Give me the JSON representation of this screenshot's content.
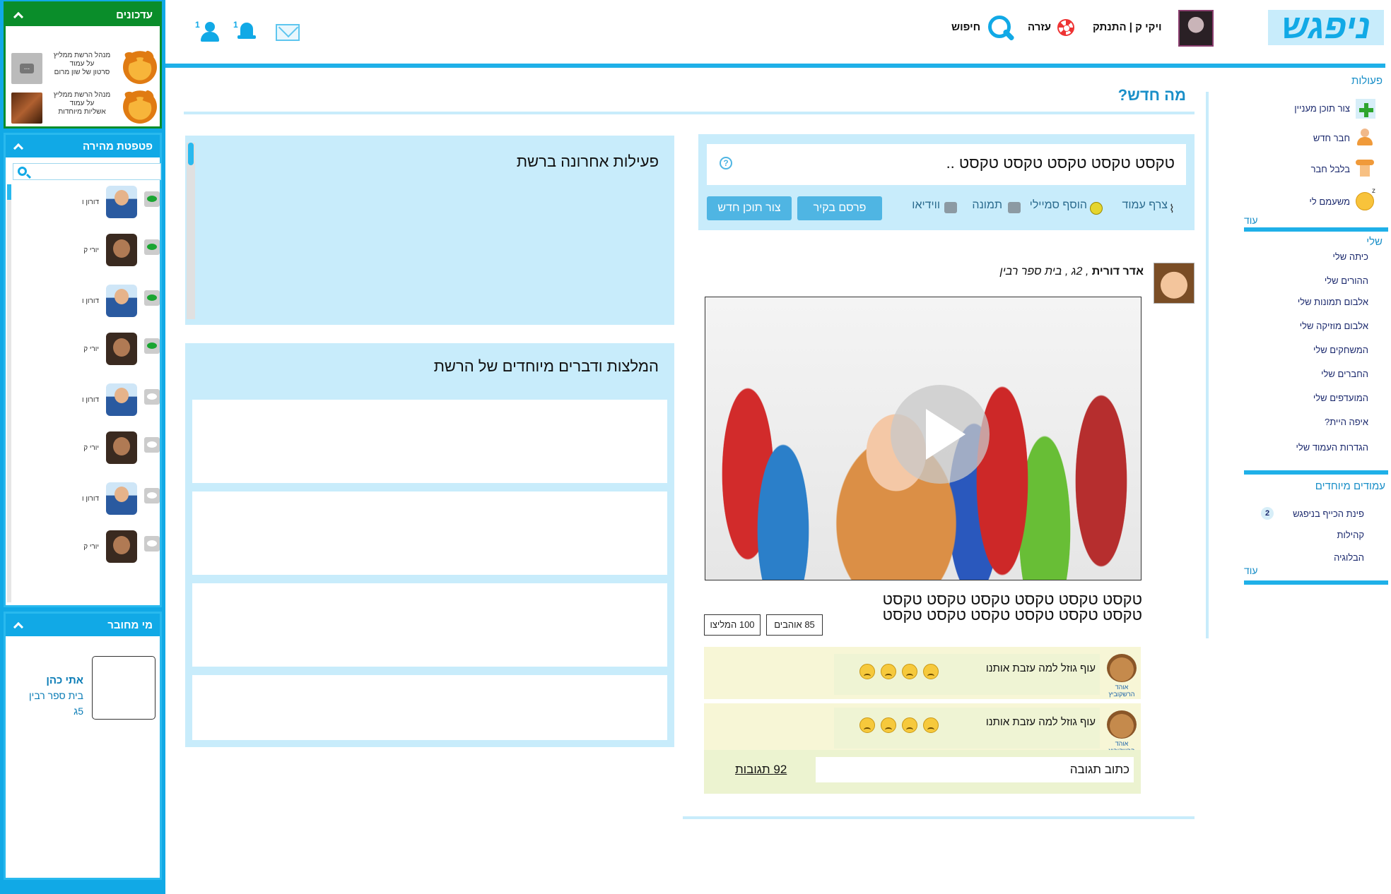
{
  "header": {
    "logo": "ניפגש",
    "user_link": "ויקי ק | התנתק",
    "help": "עזרה",
    "search": "חיפוש",
    "friends_count": "1",
    "notifications_count": "1"
  },
  "updates_panel": {
    "title": "עדכונים",
    "items": [
      {
        "line1": "מנהל הרשת ממליץ",
        "line2": "על עמוד",
        "line3": "סרטון של שון מרום",
        "thumb": "..."
      },
      {
        "line1": "מנהל הרשת ממליץ",
        "line2": "על עמוד",
        "line3": "אשליות מיוחדות"
      }
    ]
  },
  "quick_search": {
    "title": "פטפטת מהירה",
    "search_placeholder": "",
    "contacts": [
      {
        "name": "דורון ו",
        "online": true
      },
      {
        "name": "יורי ק",
        "online": true
      },
      {
        "name": "דורון ו",
        "online": true
      },
      {
        "name": "יורי ק",
        "online": true
      },
      {
        "name": "דורון ו",
        "online": false
      },
      {
        "name": "יורי ק",
        "online": false
      },
      {
        "name": "דורון ו",
        "online": false
      },
      {
        "name": "יורי ק",
        "online": false
      }
    ]
  },
  "who_online": {
    "title": "מי מחובר",
    "name": "אתי כהן",
    "school": "בית ספר רבין",
    "grade": "5ג"
  },
  "right_nav": {
    "actions_title": "פעולות",
    "actions": [
      "צור תוכן מעניין",
      "חבר חדש",
      "בלבל חבר",
      "משעמם לי"
    ],
    "more1": "עוד",
    "mine_title": "שלי",
    "mine": [
      "כיתה שלי",
      "ההורים שלי",
      "אלבום תמונות שלי",
      "אלבום מוזיקה שלי",
      "המשחקים שלי",
      "החברים שלי",
      "המועדפים שלי",
      "איפה היית?",
      "הגדרות העמוד שלי"
    ],
    "special_title": "עמודים מיוחדים",
    "special": [
      {
        "label": "פינת הכייף בניפגש",
        "badge": "2"
      },
      {
        "label": "קהילות",
        "badge": ""
      },
      {
        "label": "הבלוגיה",
        "badge": ""
      }
    ],
    "more2": "עוד"
  },
  "whats_new": {
    "title": "מה חדש?",
    "post_input": "טקסט טקסט טקסט טקסט טקסט ..",
    "help_icon": "?",
    "attach": "צרף עמוד",
    "smiley": "הוסף סמיילי",
    "image": "תמונה",
    "video": "ווידיאו",
    "publish_button": "פרסם בקיר",
    "create_button": "צור תוכן חדש"
  },
  "post": {
    "author": "אדר דורית",
    "meta": ", 2ג , בית ספר רבין",
    "text_line1": "טקסט טקסט טקסט טקסט טקסט טקסט",
    "text_line2": "טקסט טקסט טקסט טקסט טקסט טקסט",
    "likes": "85 אוהבים",
    "recommend": "100 המליצו",
    "comments": [
      {
        "text": "עוף גוזל למה עזבת אותנו",
        "author": "אוהד הרשקוביץ"
      },
      {
        "text": "עוף גוזל למה עזבת אותנו",
        "author": "אוהד הרשקוביץ"
      }
    ],
    "reply_placeholder": "כתוב תגובה",
    "reply_count": "92 תגובות"
  },
  "recent_activity": {
    "title": "פעילות אחרונה ברשת"
  },
  "recommendations": {
    "title": "המלצות ודברים מיוחדים של הרשת"
  }
}
